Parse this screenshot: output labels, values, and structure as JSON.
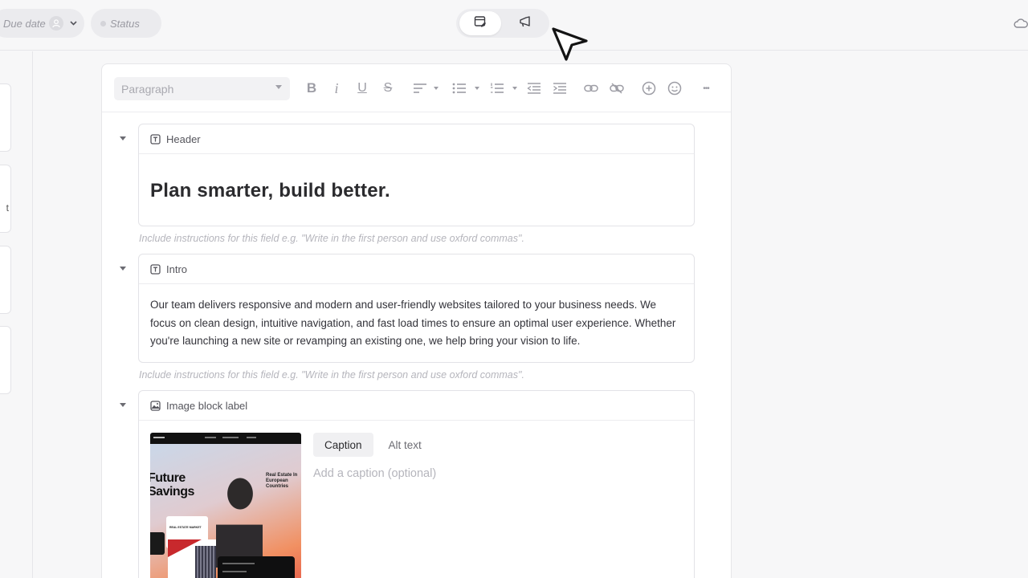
{
  "topbar": {
    "due_date_label": "Due date",
    "status_label": "Status",
    "modes": [
      {
        "name": "edit-mode",
        "icon": "note-edit-icon",
        "active": true
      },
      {
        "name": "publish-mode",
        "icon": "megaphone-icon",
        "active": false
      }
    ],
    "sync_icon": "cloud-icon"
  },
  "left_column": {
    "fragment_text": "t"
  },
  "toolbar": {
    "paragraph_select_value": "Paragraph",
    "buttons": [
      "bold",
      "italic",
      "underline",
      "strikethrough",
      "align",
      "bullet-list",
      "numbered-list",
      "outdent",
      "indent",
      "link",
      "unlink",
      "add",
      "emoji",
      "more"
    ],
    "bold_glyph": "B",
    "italic_glyph": "i",
    "underline_glyph": "U",
    "strike_glyph": "S",
    "more_glyph": "•••"
  },
  "blocks": {
    "header": {
      "label": "Header",
      "content": "Plan smarter, build better.",
      "hint": "Include instructions for this field e.g. \"Write in the first person and use oxford commas\"."
    },
    "intro": {
      "label": "Intro",
      "content": "Our team delivers responsive and modern and user-friendly websites tailored to your business needs. We focus on clean design, intuitive navigation, and fast load times to ensure an optimal user experience. Whether you're launching a new site or revamping an existing one, we help bring your vision to life.",
      "hint": "Include instructions for this field e.g. \"Write in the first person and use oxford commas\"."
    },
    "image": {
      "label": "Image block label",
      "tabs": [
        "Caption",
        "Alt text"
      ],
      "active_tab": "Caption",
      "caption_placeholder": "Add a caption (optional)",
      "thumbnail": {
        "headline_line1": "Future",
        "headline_line2": "Savings",
        "side_text": "Real Estate In European Countries",
        "card_text": "REAL ESTATE MARKET"
      }
    }
  },
  "colors": {
    "background": "#f7f7f8",
    "panel": "#ffffff",
    "hint": "#b5b5bc",
    "icon": "#9d9da5"
  }
}
